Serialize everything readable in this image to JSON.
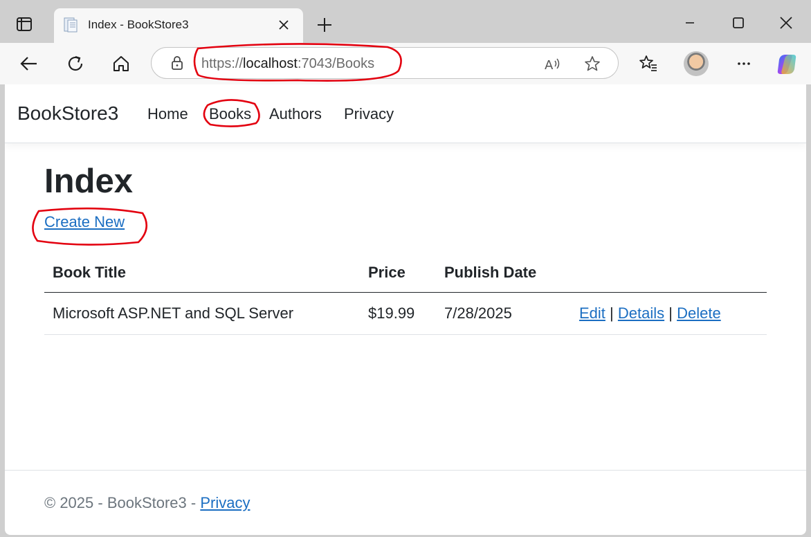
{
  "browser": {
    "tab": {
      "title": "Index - BookStore3"
    },
    "address": {
      "scheme": "https://",
      "host": "localhost",
      "rest": ":7043/Books"
    },
    "icons": [
      "tab-actions-icon",
      "page-favicon-icon",
      "tab-close-icon",
      "new-tab-icon",
      "minimize-icon",
      "maximize-icon",
      "close-window-icon",
      "back-icon",
      "refresh-icon",
      "home-icon",
      "lock-icon",
      "read-aloud-icon",
      "favorite-star-icon",
      "favorites-icon",
      "more-icon",
      "copilot-icon"
    ]
  },
  "site": {
    "brand": "BookStore3",
    "nav": {
      "home": "Home",
      "books": "Books",
      "authors": "Authors",
      "privacy": "Privacy"
    }
  },
  "page": {
    "heading": "Index",
    "create_link": "Create New",
    "table": {
      "headers": {
        "title": "Book Title",
        "price": "Price",
        "date": "Publish Date"
      },
      "rows": [
        {
          "title": "Microsoft ASP.NET and SQL Server",
          "price": "$19.99",
          "date": "7/28/2025",
          "edit": "Edit",
          "details": "Details",
          "delete": "Delete",
          "sep": "|"
        }
      ]
    }
  },
  "footer": {
    "text": "© 2025 - BookStore3 - ",
    "privacy": "Privacy"
  },
  "colors": {
    "link": "#1b6ec2",
    "text": "#212529",
    "annotation": "#e3000f",
    "chrome": "#cfcfcf"
  }
}
